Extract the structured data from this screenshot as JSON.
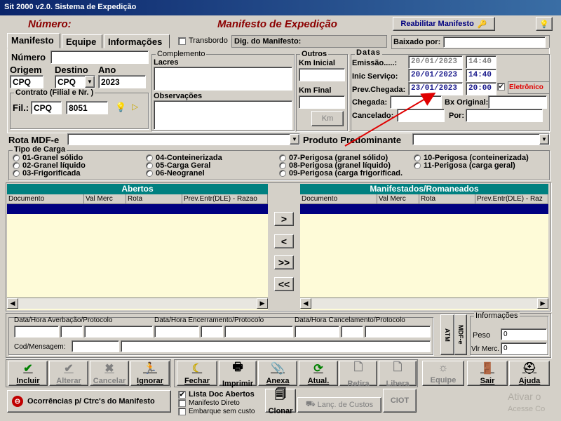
{
  "window": {
    "title": "Sit 2000 v2.0. Sistema de Expedição"
  },
  "header": {
    "numero_label": "Número:",
    "title": "Manifesto de Expedição",
    "reabilitar_label": "Reabilitar Manifesto"
  },
  "tabs": [
    "Manifesto",
    "Equipe",
    "Informações"
  ],
  "transbordo": {
    "label": "Transbordo",
    "checked": false
  },
  "dig_manifesto_label": "Dig. do Manifesto:",
  "baixado_por_label": "Baixado por:",
  "form": {
    "numero_label": "Número",
    "origem_label": "Origem",
    "destino_label": "Destino",
    "ano_label": "Ano",
    "origem_value": "CPQ",
    "destino_value": "CPQ",
    "ano_value": "2023",
    "contrato_title": "Contrato (Filial e Nr. )",
    "fil_label": "Fil.:",
    "fil_value": "CPQ",
    "contrato_nr": "8051"
  },
  "complemento": {
    "title": "Complemento",
    "lacres_label": "Lacres",
    "observacoes_label": "Observações"
  },
  "outros": {
    "title": "Outros",
    "km_inicial_label": "Km Inicial",
    "km_final_label": "Km Final",
    "km_button": "Km"
  },
  "datas": {
    "title": "Datas",
    "emissao_label": "Emissão.....:",
    "emissao_date": "20/01/2023",
    "emissao_time": "14:40",
    "inic_servico_label": "Inic Serviço:",
    "inic_date": "20/01/2023",
    "inic_time": "14:40",
    "prev_chegada_label": "Prev.Chegada:",
    "prev_date": "23/01/2023",
    "prev_time": "20:00",
    "eletronico_label": "Eletrônico",
    "chegada_label": "Chegada:",
    "bx_original_label": "Bx Original:",
    "cancelado_label": "Cancelado:",
    "por_label": "Por:"
  },
  "rota_mdfe_label": "Rota MDF-e",
  "produto_label": "Produto Predominante",
  "tipo_carga": {
    "title": "Tipo de Carga",
    "options": [
      "01-Granel sólido",
      "02-Granel líquido",
      "03-Frigorificada",
      "04-Conteinerizada",
      "05-Carga Geral",
      "06-Neogranel",
      "07-Perigosa (granel sólido)",
      "08-Perigosa (granel líquido)",
      "09-Perigosa (carga frigorificad.",
      "10-Perigosa (conteinerizada)",
      "11-Perigosa (carga geral)"
    ]
  },
  "abertos": {
    "title": "Abertos",
    "columns": [
      "Documento",
      "Val Merc",
      "Rota",
      "Prev.Entr(DLE) - Razao"
    ]
  },
  "manifestados": {
    "title": "Manifestados/Romaneados",
    "columns": [
      "Documento",
      "Val Merc",
      "Rota",
      "Prev.Entr(DLE) - Raz"
    ]
  },
  "transfer_buttons": [
    ">",
    "<",
    ">>",
    "<<"
  ],
  "averbacao": {
    "averbacao_label": "Data/Hora Averbação/Protocolo",
    "encerramento_label": "Data/Hora Encerramento/Protocolo",
    "cancelamento_label": "Data/Hora Cancelamento/Protocolo",
    "cod_mensagem_label": "Cod/Mensagem:",
    "atm_label": "ATM",
    "mdfe_label": "MDF-e"
  },
  "informacoes": {
    "title": "Informações",
    "peso_label": "Peso",
    "peso_value": "0",
    "vlr_merc_label": "Vlr Merc.",
    "vlr_merc_value": "0"
  },
  "actions": {
    "incluir": "Incluir",
    "alterar": "Alterar",
    "cancelar": "Cancelar",
    "ignorar": "Ignorar",
    "fechar": "Fechar",
    "imprimir": "Imprimir",
    "anexa": "Anexa",
    "atual": "Atual.",
    "retira": "Retira",
    "libera": "Libera",
    "equipe": "Equipe",
    "sair": "Sair",
    "ajuda": "Ajuda",
    "ocorrencias": "Ocorrências p/ Ctrc's do Manifesto",
    "lista_doc_abertos": "Lista Doc Abertos",
    "manifesto_direto": "Manifesto Direto",
    "embarque_sem_custo": "Embarque sem custo",
    "clonar": "Clonar",
    "lanc_custos": "Lanç. de Custos",
    "ciot": "CIOT"
  },
  "watermark": {
    "line1": "Ativar o",
    "line2": "Acesse Co"
  },
  "colors": {
    "accent_red": "#8b0000",
    "teal_header": "#008080",
    "selected_row": "#000080"
  }
}
